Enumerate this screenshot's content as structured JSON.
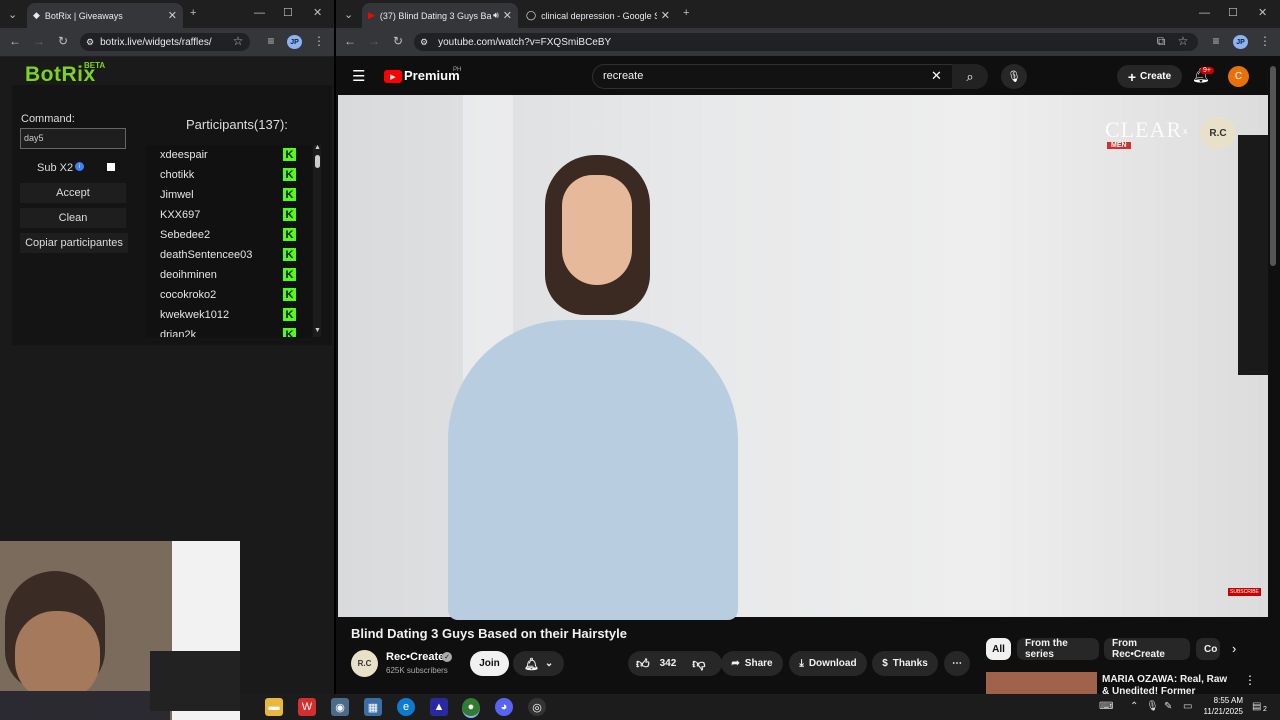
{
  "left_window": {
    "tab_title": "BotRix | Giveaways",
    "url": "botrix.live/widgets/raffles/",
    "profile_initials": "JP"
  },
  "botrix": {
    "logo": "BotRix",
    "logo_badge": "BETA",
    "command_label": "Command:",
    "command_value": "day5",
    "sub_label": "Sub X2",
    "sub_checked": false,
    "accept_label": "Accept",
    "clean_label": "Clean",
    "copy_label": "Copiar participantes",
    "participants_title": "Participants(137):",
    "participants": [
      "xdeespair",
      "chotikk",
      "Jimwel",
      "KXX697",
      "Sebedee2",
      "deathSentencee03",
      "deoihminen",
      "cocokroko2",
      "kwekwek1012",
      "drian2k"
    ]
  },
  "right_window": {
    "tab1_title": "(37) Blind Dating 3 Guys Ba",
    "tab2_title": "clinical depression - Google Se",
    "url": "youtube.com/watch?v=FXQSmiBCeBY",
    "profile_initials": "JP"
  },
  "youtube": {
    "logo_text": "Premium",
    "logo_region": "PH",
    "search_value": "recreate",
    "create_label": "Create",
    "notif_count": "9+",
    "user_initial": "C",
    "video_title": "Blind Dating 3 Guys Based on their Hairstyle",
    "channel_name": "Rec•Create",
    "channel_subs": "625K subscribers",
    "channel_avatar": "R.C",
    "join_label": "Join",
    "likes": "342",
    "share_label": "Share",
    "download_label": "Download",
    "thanks_label": "Thanks",
    "chips": [
      "All",
      "From the series",
      "From Rec•Create",
      "Co"
    ],
    "rec_title": "MARIA OZAWA: Real, Raw & Unedited! Former Japanese",
    "overlay_brand": "CLEAR",
    "overlay_x": "x",
    "overlay_men": "MEN",
    "overlay_rc": "R.C",
    "subscribe_badge": "SUBSCRIBE"
  },
  "taskbar": {
    "time": "8:55 AM",
    "date": "11/21/2025",
    "notif_count": "2"
  }
}
